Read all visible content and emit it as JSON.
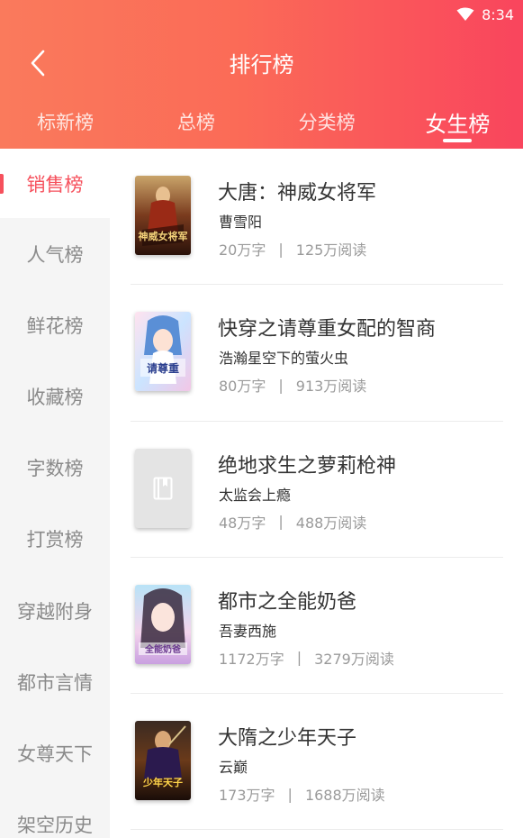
{
  "status_bar": {
    "time": "8:34"
  },
  "header": {
    "title": "排行榜",
    "tabs": [
      {
        "label": "标新榜",
        "active": false
      },
      {
        "label": "总榜",
        "active": false
      },
      {
        "label": "分类榜",
        "active": false
      },
      {
        "label": "女生榜",
        "active": true
      }
    ]
  },
  "sidebar": {
    "items": [
      {
        "label": "销售榜",
        "active": true
      },
      {
        "label": "人气榜",
        "active": false
      },
      {
        "label": "鲜花榜",
        "active": false
      },
      {
        "label": "收藏榜",
        "active": false
      },
      {
        "label": "字数榜",
        "active": false
      },
      {
        "label": "打赏榜",
        "active": false
      },
      {
        "label": "穿越附身",
        "active": false
      },
      {
        "label": "都市言情",
        "active": false
      },
      {
        "label": "女尊天下",
        "active": false
      },
      {
        "label": "架空历史",
        "active": false
      }
    ]
  },
  "books": [
    {
      "title": "大唐：神威女将军",
      "author": "曹雪阳",
      "words": "20万字",
      "reads": "125万阅读",
      "cover_text": "神威女将军"
    },
    {
      "title": "快穿之请尊重女配的智商",
      "author": "浩瀚星空下的萤火虫",
      "words": "80万字",
      "reads": "913万阅读",
      "cover_text": "请尊重"
    },
    {
      "title": "绝地求生之萝莉枪神",
      "author": "太监会上瘾",
      "words": "48万字",
      "reads": "488万阅读",
      "cover_text": ""
    },
    {
      "title": "都市之全能奶爸",
      "author": "吾妻西施",
      "words": "1172万字",
      "reads": "3279万阅读",
      "cover_text": "全能奶爸"
    },
    {
      "title": "大隋之少年天子",
      "author": "云巅",
      "words": "173万字",
      "reads": "1688万阅读",
      "cover_text": "少年天子"
    }
  ],
  "meta_separator": "|",
  "colors": {
    "accent": "#f6505c",
    "header_start": "#fa7a5c",
    "header_end": "#f9455d",
    "sidebar_bg": "#f5f5f5"
  }
}
